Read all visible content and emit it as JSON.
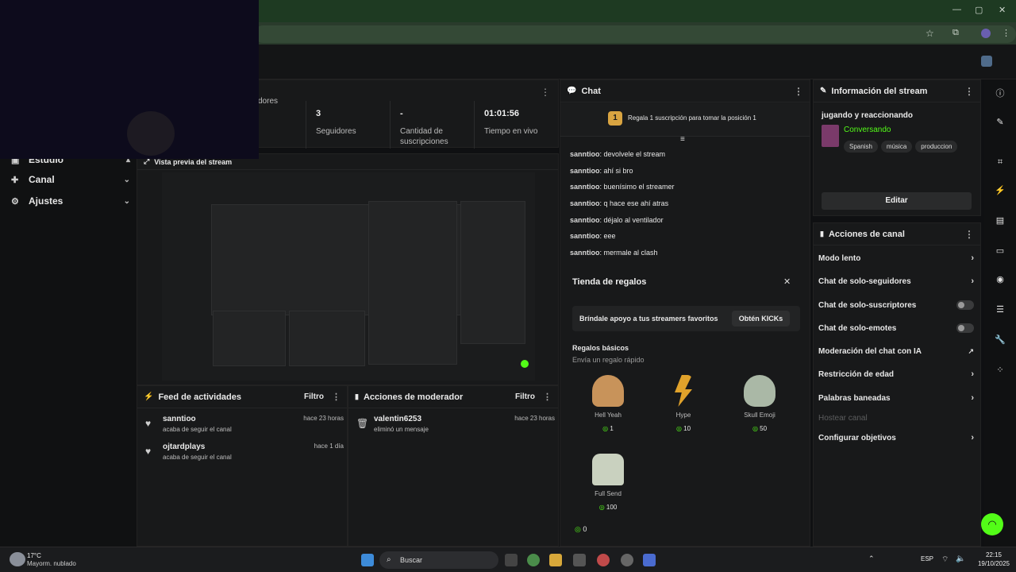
{
  "window": {
    "minimize": "—",
    "maximize": "▢",
    "close": "✕"
  },
  "nav": {
    "items": [
      {
        "label": "Estudio"
      },
      {
        "label": "Canal"
      },
      {
        "label": "Ajustes"
      }
    ]
  },
  "stats": [
    {
      "value": "",
      "label": "dores"
    },
    {
      "value": "3",
      "label": "Seguidores"
    },
    {
      "value": "-",
      "label": "Cantidad de suscripciones"
    },
    {
      "value": "01:01:56",
      "label": "Tiempo en vivo"
    }
  ],
  "preview": {
    "title": "Vista previa del stream"
  },
  "feed": {
    "title": "Feed de actividades",
    "filter": "Filtro",
    "rows": [
      {
        "name": "sanntioo",
        "desc": "acaba de seguir el canal",
        "time": "hace 23 horas"
      },
      {
        "name": "ojtardplays",
        "desc": "acaba de seguir el canal",
        "time": "hace 1 día"
      }
    ]
  },
  "modactions": {
    "title": "Acciones de moderador",
    "filter": "Filtro",
    "rows": [
      {
        "name": "valentin6253",
        "desc": "eliminó un mensaje",
        "time": "hace 23 horas"
      }
    ]
  },
  "chat": {
    "title": "Chat",
    "pinned_rank": "1",
    "pinned_text": "Regala 1 suscripción para tomar la posición 1",
    "messages": [
      {
        "user": "sanntioo",
        "text": "devolvele el stream"
      },
      {
        "user": "sanntioo",
        "text": "ahí si bro"
      },
      {
        "user": "sanntioo",
        "text": "buenísimo el streamer"
      },
      {
        "user": "sanntioo",
        "text": "q hace ese ahí atras"
      },
      {
        "user": "sanntioo",
        "text": "déjalo al ventilador"
      },
      {
        "user": "sanntioo",
        "text": "eee"
      },
      {
        "user": "sanntioo",
        "text": "mermale al clash"
      }
    ],
    "balance": "0"
  },
  "giftshop": {
    "title": "Tienda de regalos",
    "banner": "Bríndale apoyo a tus streamers favoritos",
    "banner_button": "Obtén KICKs",
    "section_title": "Regalos básicos",
    "section_sub": "Envía un regalo rápido",
    "gifts": [
      {
        "name": "Hell Yeah",
        "price": "1"
      },
      {
        "name": "Hype",
        "price": "10"
      },
      {
        "name": "Skull Emoji",
        "price": "50"
      },
      {
        "name": "Full Send",
        "price": "100"
      }
    ]
  },
  "streaminfo": {
    "title": "Información del stream",
    "stream_title": "jugando y reaccionando",
    "category": "Conversando",
    "tags": [
      "Spanish",
      "música",
      "produccion"
    ],
    "edit": "Editar"
  },
  "channelactions": {
    "title": "Acciones de canal",
    "items": [
      {
        "label": "Modo lento",
        "kind": "arrow"
      },
      {
        "label": "Chat de solo-seguidores",
        "kind": "arrow"
      },
      {
        "label": "Chat de solo-suscriptores",
        "kind": "toggle"
      },
      {
        "label": "Chat de solo-emotes",
        "kind": "toggle"
      },
      {
        "label": "Moderación del chat con IA",
        "kind": "external"
      },
      {
        "label": "Restricción de edad",
        "kind": "arrow"
      },
      {
        "label": "Palabras baneadas",
        "kind": "arrow"
      },
      {
        "label": "Hostear canal",
        "kind": "disabled"
      },
      {
        "label": "Configurar objetivos",
        "kind": "arrow"
      }
    ]
  },
  "taskbar": {
    "weather_temp": "17°C",
    "weather_desc": "Mayorm. nublado",
    "search": "Buscar",
    "lang": "ESP",
    "time": "22:15",
    "date": "19/10/2025"
  },
  "colors": {
    "accent": "#53fc18",
    "pinned_badge": "#d9a441"
  }
}
